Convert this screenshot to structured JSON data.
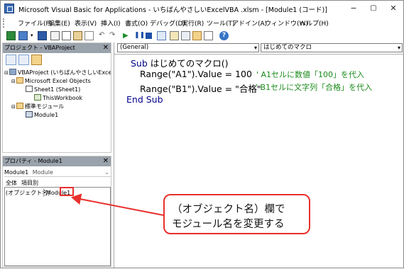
{
  "window": {
    "title": "Microsoft Visual Basic for Applications - いちばんやさしいExcelVBA .xlsm - [Module1 (コード)]",
    "minimize": "−",
    "restore": "▢",
    "close": "✕"
  },
  "menu": [
    "ファイル(F)",
    "編集(E)",
    "表示(V)",
    "挿入(I)",
    "書式(O)",
    "デバッグ(D)",
    "実行(R)",
    "ツール(T)",
    "アドイン(A)",
    "ウィンドウ(W)",
    "ヘルプ(H)"
  ],
  "project_pane": {
    "title": "プロジェクト - VBAProject",
    "close": "✕",
    "tree": {
      "root": "VBAProject (いちばんやさしいExcel",
      "folder_objects": "Microsoft Excel Objects",
      "sheet1": "Sheet1 (Sheet1)",
      "workbook": "ThisWorkbook",
      "folder_modules": "標準モジュール",
      "module1": "Module1"
    }
  },
  "properties_pane": {
    "title": "プロパティ - Module1",
    "close": "✕",
    "object_combo": "Module1",
    "object_type": "Module",
    "tab_all": "全体",
    "tab_category": "項目別",
    "property_name": "(オブジェクト名)",
    "property_value": "Module1"
  },
  "code_window": {
    "object_combo": "(General)",
    "proc_combo": "はじめてのマクロ",
    "lines": {
      "l1_kw": "Sub",
      "l1_rest": " はじめてのマクロ()",
      "l2_code": "Range(\"A1\").Value = 100",
      "l2_comment": "' A1セルに数値「100」を代入",
      "l3_code": "Range(\"B1\").Value = \"合格\"",
      "l3_comment": "' B1セルに文字列「合格」を代入",
      "l4_kw": "End Sub"
    }
  },
  "annotation": {
    "line1": "（オブジェクト名）欄で",
    "line2": "モジュール名を変更する"
  },
  "colors": {
    "keyword": "#00008b",
    "comment": "#1a8a1a",
    "callout_border": "#e8302d"
  }
}
